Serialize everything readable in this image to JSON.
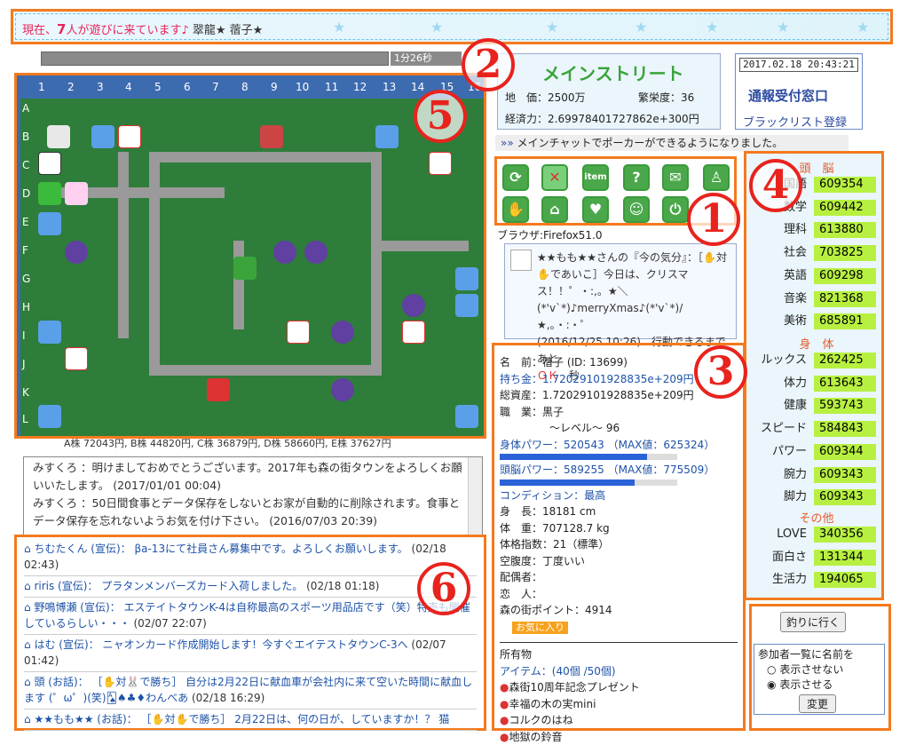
{
  "top_banner": {
    "text_prefix": "現在、",
    "count": "7",
    "text_suffix": "人が遊びに来ています♪",
    "names": "翠龍★ 蓿子★"
  },
  "timer_bar": {
    "label": "1分26秒"
  },
  "map": {
    "col_labels": [
      "1",
      "2",
      "3",
      "4",
      "5",
      "6",
      "7",
      "8",
      "9",
      "10",
      "11",
      "12",
      "13",
      "14",
      "15",
      "16"
    ],
    "row_labels": [
      "A",
      "B",
      "C",
      "D",
      "E",
      "F",
      "G",
      "H",
      "I",
      "J",
      "K",
      "L"
    ],
    "stock_line": "A株 72043円, B株 44820円, C株 36879円, D株 58660円, E株 37627円"
  },
  "street": {
    "title": "メインストリート",
    "land_label": "地　価：",
    "land_value": "2500万",
    "prosperity_label": "繁栄度：",
    "prosperity_value": "36",
    "economy_label": "経済力：",
    "economy_value": "2.69978401727862e+300円"
  },
  "clock": {
    "datetime": "2017.02.18 20:43:21",
    "report": "通報受付窓口",
    "blacklist": "ブラックリスト登録"
  },
  "notice": {
    "text": "メインチャットでポーカーができるようになりました。"
  },
  "icons": [
    "refresh-icon",
    "no-entry-icon",
    "item-icon",
    "question-icon",
    "mail-icon",
    "users-icon",
    "hand-icon",
    "home-icon",
    "heart-icon",
    "smile-icon",
    "power-icon"
  ],
  "icon_item_label": "item",
  "browser": "ブラウザ:Firefox51.0",
  "mood": {
    "line1": "★★もも★★さんの『今の気分』：［✋対✋であいこ］今日は、クリスマス！！゜・:,。★＼(*'v`*)♪merryXmas♪(*'v`*)/★,。・:・゜",
    "timestamp": "(2016/12/25 10:26)",
    "action": "行動できるまであと",
    "ok": "ＯＫ",
    "sec": "秒"
  },
  "profile": {
    "name": "名　前：蓿子 (ID: 13699)",
    "money": "持ち金：1.72029101928835e+209円",
    "assets": "総資産：1.72029101928835e+209円",
    "job": "職　業：黒子",
    "level": "～レベル～ 96",
    "body_power": "身体パワー：520543 （MAX値：625324）",
    "body_frac": 0.832,
    "brain_power": "頭脳パワー：589255 （MAX値：775509）",
    "brain_frac": 0.76,
    "condition": "コンディション：最高",
    "height": "身　長：18181 cm",
    "weight": "体　重：707128.7 kg",
    "bmi": "体格指数：21（標準）",
    "hunger": "空腹度：丁度いい",
    "spouse": "配偶者：",
    "lover": "恋　人：",
    "points": "森の街ポイント：4914",
    "fav": "お気に入り",
    "items_title": "所有物",
    "items_count": "アイテム：(40個 /50個)",
    "items": [
      "森街10周年記念プレゼント",
      "幸福の木の実mini",
      "コルクのはね",
      "地獄の鈴音"
    ]
  },
  "stats": {
    "brain_title": "頭　脳",
    "brain": [
      {
        "k": "国語",
        "v": "609354"
      },
      {
        "k": "数学",
        "v": "609442"
      },
      {
        "k": "理科",
        "v": "613880"
      },
      {
        "k": "社会",
        "v": "703825"
      },
      {
        "k": "英語",
        "v": "609298"
      },
      {
        "k": "音楽",
        "v": "821368"
      },
      {
        "k": "美術",
        "v": "685891"
      }
    ],
    "body_title": "身　体",
    "body": [
      {
        "k": "ルックス",
        "v": "262425"
      },
      {
        "k": "体力",
        "v": "613643"
      },
      {
        "k": "健康",
        "v": "593743"
      },
      {
        "k": "スピード",
        "v": "584843"
      },
      {
        "k": "パワー",
        "v": "609344"
      },
      {
        "k": "腕力",
        "v": "609343"
      },
      {
        "k": "脚力",
        "v": "609343"
      }
    ],
    "other_title": "その他",
    "other": [
      {
        "k": "LOVE",
        "v": "340356"
      },
      {
        "k": "面白さ",
        "v": "131344"
      },
      {
        "k": "生活力",
        "v": "194065"
      }
    ]
  },
  "chat": [
    "みすくろ ：明けましておめでとうございます。2017年も森の街タウンをよろしくお願いいたします。 (2017/01/01 00:04)",
    "みすくろ ：50日間食事とデータ保存をしないとお家が自動的に削除されます。食事とデータ保存を忘れないようお気を付け下さい。 (2016/07/03 20:39)"
  ],
  "ads": [
    {
      "user": "ちむたくん (宣伝)：",
      "msg": "βa-13にて社員さん募集中です。よろしくお願いします。",
      "time": "(02/18 02:43)"
    },
    {
      "user": "riris (宣伝)：",
      "msg": "プラタンメンバーズカード入荷しました。",
      "time": "(02/18 01:18)"
    },
    {
      "user": "野鳴博瀬 (宣伝)：",
      "msg": "エステイトタウンK-4は自称最高のスポーツ用品店です（笑）特売も開催しているらしい・・・",
      "time": "(02/07 22:07)"
    },
    {
      "user": "はむ (宣伝)：",
      "msg": "ニャオンカード作成開始します！今すぐエイテストタウンC-3へ",
      "time": "(02/07 01:42)"
    },
    {
      "user": "頭 (お話)：",
      "msg": "［✋対🐰で勝ち］ 自分は2月22日に献血車が会社内に来て空いた時間に献血します (゜ω゜)(笑)🂡♠♣♦わんべあ",
      "time": "(02/18 16:29)"
    },
    {
      "user": "★★もも★★ (お話)：",
      "msg": "［✋対✋で勝ち］ 2月22日は、何の日が、していますか！？ 猫",
      "time": ""
    }
  ],
  "fishing": {
    "label": "釣りに行く"
  },
  "participants": {
    "title": "参加者一覧に名前を",
    "opt1": "表示させない",
    "opt2": "表示させる",
    "change": "変更"
  },
  "annotations": [
    "1",
    "2",
    "3",
    "4",
    "5",
    "6"
  ]
}
